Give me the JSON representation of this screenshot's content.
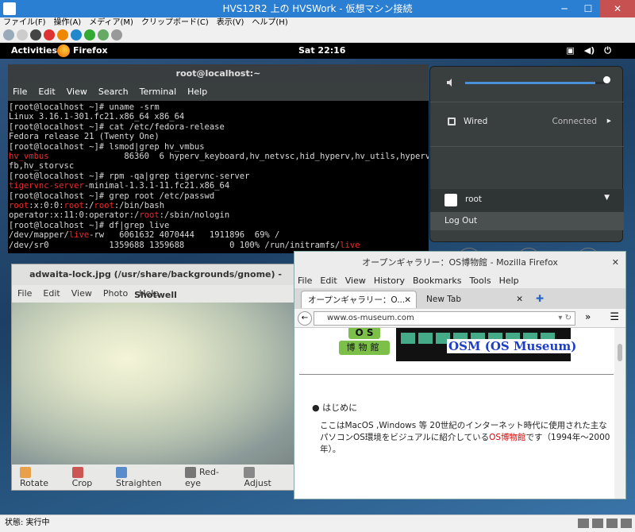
{
  "host": {
    "title": "HVS12R2 上の HVSWork - 仮想マシン接続",
    "menu": [
      "ファイル(F)",
      "操作(A)",
      "メディア(M)",
      "クリップボード(C)",
      "表示(V)",
      "ヘルプ(H)"
    ],
    "status": "状態: 実行中"
  },
  "gnome": {
    "activities": "Activities",
    "app": "Firefox",
    "clock": "Sat 22:16"
  },
  "terminal": {
    "title": "root@localhost:~",
    "menu": [
      "File",
      "Edit",
      "View",
      "Search",
      "Terminal",
      "Help"
    ],
    "lines": [
      [
        {
          "t": "[root@localhost ~]# uname -srm"
        }
      ],
      [
        {
          "t": "Linux 3.16.1-301.fc21.x86_64 x86_64"
        }
      ],
      [
        {
          "t": "[root@localhost ~]# cat /etc/fedora-release"
        }
      ],
      [
        {
          "t": "Fedora release 21 (Twenty One)"
        }
      ],
      [
        {
          "t": "[root@localhost ~]# lsmod|grep hv_vmbus"
        }
      ],
      [
        {
          "t": "hv_vmbus",
          "r": true
        },
        {
          "t": "               86360  6 hyperv_keyboard,hv_netvsc,hid_hyperv,hv_utils,hyperv_"
        }
      ],
      [
        {
          "t": "fb,hv_storvsc"
        }
      ],
      [
        {
          "t": "[root@localhost ~]# rpm -qa|grep tigervnc-server"
        }
      ],
      [
        {
          "t": "tigervnc-server",
          "r": true
        },
        {
          "t": "-minimal-1.3.1-11.fc21.x86_64"
        }
      ],
      [
        {
          "t": "[root@localhost ~]# grep root /etc/passwd"
        }
      ],
      [
        {
          "t": "root",
          "r": true
        },
        {
          "t": ":x:0:0:"
        },
        {
          "t": "root",
          "r": true
        },
        {
          "t": ":/"
        },
        {
          "t": "root",
          "r": true
        },
        {
          "t": ":/bin/bash"
        }
      ],
      [
        {
          "t": "operator:x:11:0:operator:/"
        },
        {
          "t": "root",
          "r": true
        },
        {
          "t": ":/sbin/nologin"
        }
      ],
      [
        {
          "t": "[root@localhost ~]# df|grep live"
        }
      ],
      [
        {
          "t": "/dev/mapper/"
        },
        {
          "t": "live",
          "r": true
        },
        {
          "t": "-rw   6061632 4070444   1911896  69% /"
        }
      ],
      [
        {
          "t": "/dev/sr0            1359688 1359688         0 100% /run/initramfs/"
        },
        {
          "t": "live",
          "r": true
        }
      ]
    ]
  },
  "sysmenu": {
    "volume_level": 0.92,
    "wired_label": "Wired",
    "wired_status": "Connected",
    "user": "root",
    "logout": "Log Out"
  },
  "shotwell": {
    "title": "adwaita-lock.jpg (/usr/share/backgrounds/gnome) - Shotwell",
    "menu": [
      "File",
      "Edit",
      "View",
      "Photo",
      "Help"
    ],
    "tools": [
      "Rotate",
      "Crop",
      "Straighten",
      "Red-eye",
      "Adjust"
    ]
  },
  "firefox": {
    "title": "オープンギャラリー：OS博物館 - Mozilla Firefox",
    "menu": [
      "File",
      "Edit",
      "View",
      "History",
      "Bookmarks",
      "Tools",
      "Help"
    ],
    "tab1": "オープンギャラリー：O...",
    "tab2": "New Tab",
    "url": "www.os-museum.com",
    "logo_top": "O S",
    "logo_bottom": "博物館",
    "site_title": "OSM (OS Museum)",
    "bullet": "はじめに",
    "para_before": "ここはMacOS ,Windows 等 20世紀のインターネット時代に使用された主なパソコンOS環境をビジュアルに紹介している",
    "para_highlight": "OS博物館",
    "para_after": "です（1994年〜2000年）。"
  }
}
